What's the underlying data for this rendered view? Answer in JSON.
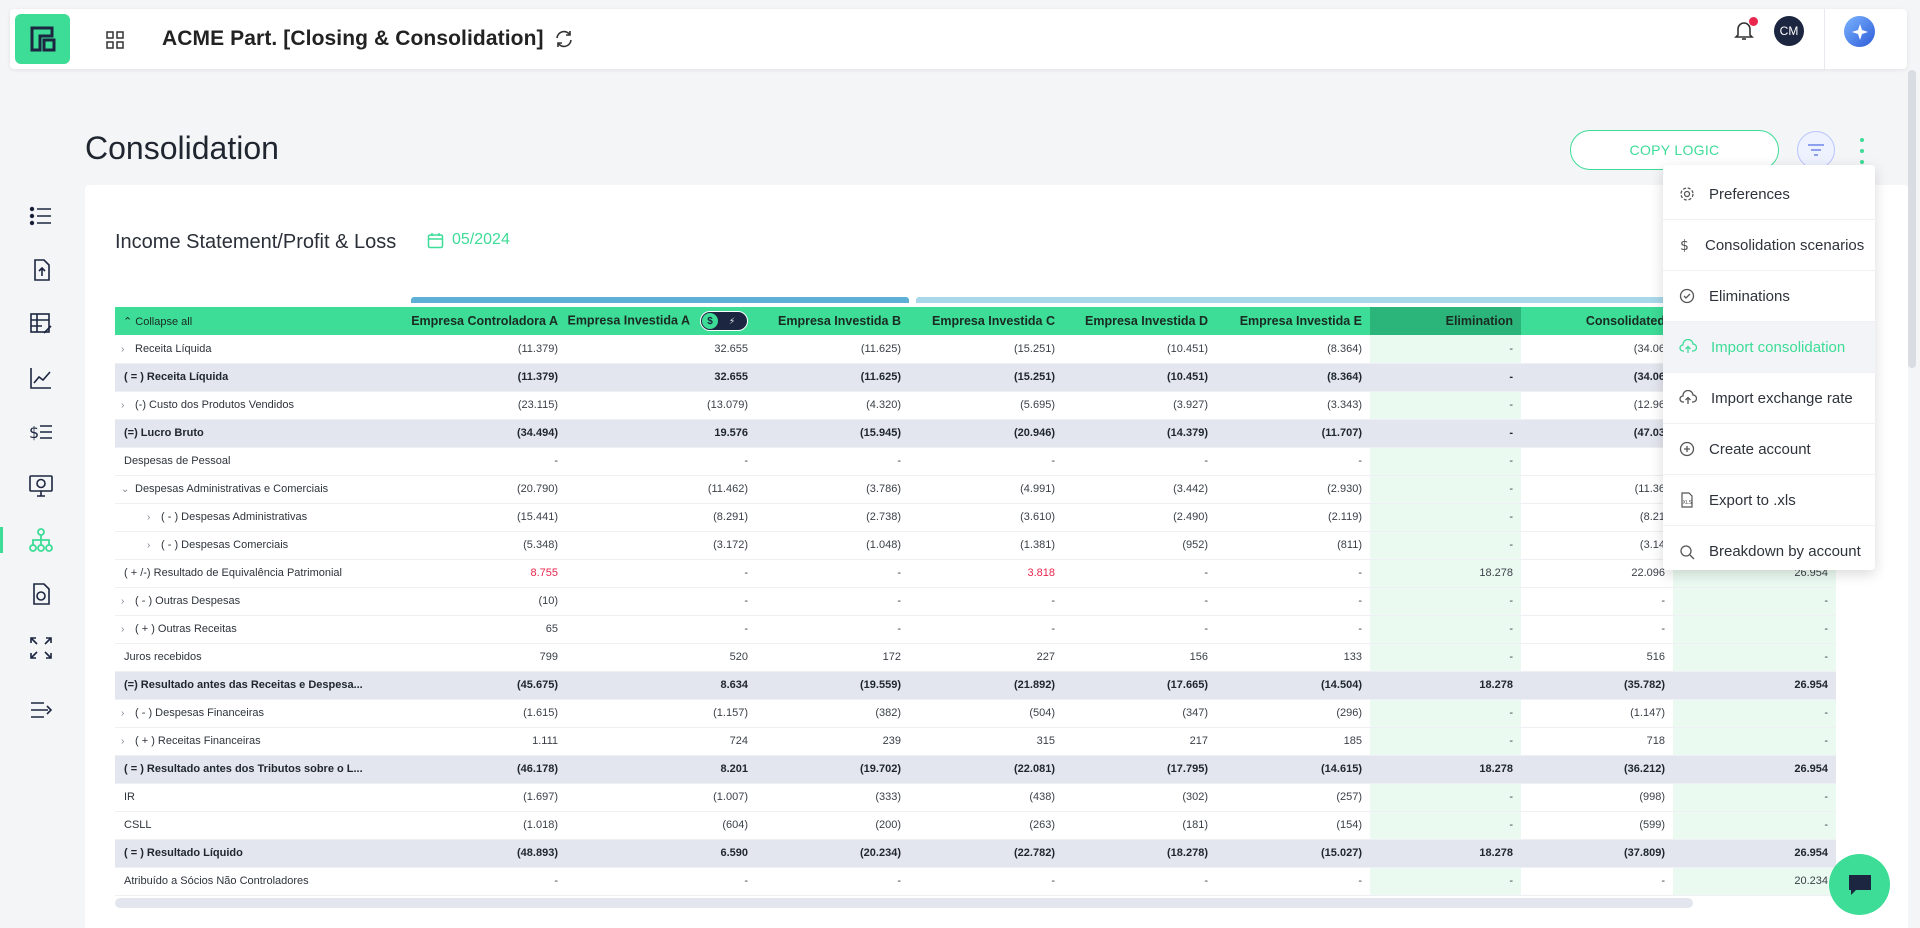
{
  "app": {
    "title": "ACME Part. [Closing & Consolidation]",
    "avatar_initials": "CM",
    "accent": "#3ddc97"
  },
  "page": {
    "title": "Consolidation",
    "copy_logic_label": "COPY LOGIC"
  },
  "report": {
    "title": "Income Statement/Profit & Loss",
    "period": "05/2024",
    "collapse_label": "Collapse all"
  },
  "columns": [
    "Empresa Controladora A",
    "Empresa Investida A",
    "Empresa Investida B",
    "Empresa Investida C",
    "Empresa Investida D",
    "Empresa Investida E",
    "Elimination",
    "Consolidated"
  ],
  "rows": [
    {
      "label": "Receita Líquida",
      "chev": ">",
      "total": false,
      "v": [
        "(11.379)",
        "32.655",
        "(11.625)",
        "(15.251)",
        "(10.451)",
        "(8.364)",
        "-",
        "(34.06"
      ],
      "x": ""
    },
    {
      "label": "( = ) Receita Líquida",
      "chev": "",
      "total": true,
      "v": [
        "(11.379)",
        "32.655",
        "(11.625)",
        "(15.251)",
        "(10.451)",
        "(8.364)",
        "-",
        "(34.06"
      ],
      "x": ""
    },
    {
      "label": "(-) Custo dos Produtos Vendidos",
      "chev": ">",
      "total": false,
      "v": [
        "(23.115)",
        "(13.079)",
        "(4.320)",
        "(5.695)",
        "(3.927)",
        "(3.343)",
        "-",
        "(12.96"
      ],
      "x": ""
    },
    {
      "label": "(=) Lucro Bruto",
      "chev": "",
      "total": true,
      "v": [
        "(34.494)",
        "19.576",
        "(15.945)",
        "(20.946)",
        "(14.379)",
        "(11.707)",
        "-",
        "(47.03"
      ],
      "x": ""
    },
    {
      "label": "Despesas de Pessoal",
      "chev": "",
      "total": false,
      "v": [
        "-",
        "-",
        "-",
        "-",
        "-",
        "-",
        "-",
        ""
      ],
      "x": ""
    },
    {
      "label": "Despesas Administrativas e Comerciais",
      "chev": "v",
      "total": false,
      "v": [
        "(20.790)",
        "(11.462)",
        "(3.786)",
        "(4.991)",
        "(3.442)",
        "(2.930)",
        "-",
        "(11.36"
      ],
      "x": ""
    },
    {
      "label": "( - ) Despesas Administrativas",
      "chev": ">",
      "indent": true,
      "total": false,
      "v": [
        "(15.441)",
        "(8.291)",
        "(2.738)",
        "(3.610)",
        "(2.490)",
        "(2.119)",
        "-",
        "(8.21"
      ],
      "x": ""
    },
    {
      "label": "( - ) Despesas Comerciais",
      "chev": ">",
      "indent": true,
      "total": false,
      "v": [
        "(5.348)",
        "(3.172)",
        "(1.048)",
        "(1.381)",
        "(952)",
        "(811)",
        "-",
        "(3.14"
      ],
      "x": ""
    },
    {
      "label": "( + /-) Resultado de Equivalência Patrimonial",
      "chev": "",
      "total": false,
      "v": [
        "8.755",
        "-",
        "-",
        "3.818",
        "-",
        "-",
        "18.278",
        "22.096"
      ],
      "x": "26.954",
      "red": [
        0,
        3
      ]
    },
    {
      "label": "( - ) Outras Despesas",
      "chev": ">",
      "total": false,
      "v": [
        "(10)",
        "-",
        "-",
        "-",
        "-",
        "-",
        "-",
        "-"
      ],
      "x": "-"
    },
    {
      "label": "( + ) Outras Receitas",
      "chev": ">",
      "total": false,
      "v": [
        "65",
        "-",
        "-",
        "-",
        "-",
        "-",
        "-",
        "-"
      ],
      "x": "-"
    },
    {
      "label": "Juros recebidos",
      "chev": "",
      "total": false,
      "v": [
        "799",
        "520",
        "172",
        "227",
        "156",
        "133",
        "-",
        "516"
      ],
      "x": "-"
    },
    {
      "label": "(=) Resultado antes das Receitas e Despesa...",
      "chev": "",
      "total": true,
      "v": [
        "(45.675)",
        "8.634",
        "(19.559)",
        "(21.892)",
        "(17.665)",
        "(14.504)",
        "18.278",
        "(35.782)"
      ],
      "x": "26.954"
    },
    {
      "label": "( - ) Despesas Financeiras",
      "chev": ">",
      "total": false,
      "v": [
        "(1.615)",
        "(1.157)",
        "(382)",
        "(504)",
        "(347)",
        "(296)",
        "-",
        "(1.147)"
      ],
      "x": "-"
    },
    {
      "label": "( + ) Receitas Financeiras",
      "chev": ">",
      "total": false,
      "v": [
        "1.111",
        "724",
        "239",
        "315",
        "217",
        "185",
        "-",
        "718"
      ],
      "x": "-"
    },
    {
      "label": "( = ) Resultado antes dos Tributos sobre o L...",
      "chev": "",
      "total": true,
      "v": [
        "(46.178)",
        "8.201",
        "(19.702)",
        "(22.081)",
        "(17.795)",
        "(14.615)",
        "18.278",
        "(36.212)"
      ],
      "x": "26.954"
    },
    {
      "label": "IR",
      "chev": "",
      "total": false,
      "v": [
        "(1.697)",
        "(1.007)",
        "(333)",
        "(438)",
        "(302)",
        "(257)",
        "-",
        "(998)"
      ],
      "x": "-"
    },
    {
      "label": "CSLL",
      "chev": "",
      "total": false,
      "v": [
        "(1.018)",
        "(604)",
        "(200)",
        "(263)",
        "(181)",
        "(154)",
        "-",
        "(599)"
      ],
      "x": "-"
    },
    {
      "label": "( = ) Resultado Líquido",
      "chev": "",
      "total": true,
      "v": [
        "(48.893)",
        "6.590",
        "(20.234)",
        "(22.782)",
        "(18.278)",
        "(15.027)",
        "18.278",
        "(37.809)"
      ],
      "x": "26.954"
    },
    {
      "label": "Atribuído a Sócios Não Controladores",
      "chev": "",
      "total": false,
      "v": [
        "-",
        "-",
        "-",
        "-",
        "-",
        "-",
        "-",
        "-"
      ],
      "x": "20.234"
    }
  ],
  "menu": [
    {
      "label": "Preferences",
      "icon": "gear-icon",
      "highlight": false
    },
    {
      "label": "Consolidation scenarios",
      "icon": "dollar-icon",
      "highlight": false
    },
    {
      "label": "Eliminations",
      "icon": "check-circle-icon",
      "highlight": false
    },
    {
      "label": "Import consolidation",
      "icon": "cloud-upload-icon",
      "highlight": true
    },
    {
      "label": "Import exchange rate",
      "icon": "cloud-upload-icon",
      "highlight": false
    },
    {
      "label": "Create account",
      "icon": "plus-circle-icon",
      "highlight": false
    },
    {
      "label": "Export to .xls",
      "icon": "xls-file-icon",
      "highlight": false
    },
    {
      "label": "Breakdown by account",
      "icon": "search-icon",
      "highlight": false
    }
  ]
}
